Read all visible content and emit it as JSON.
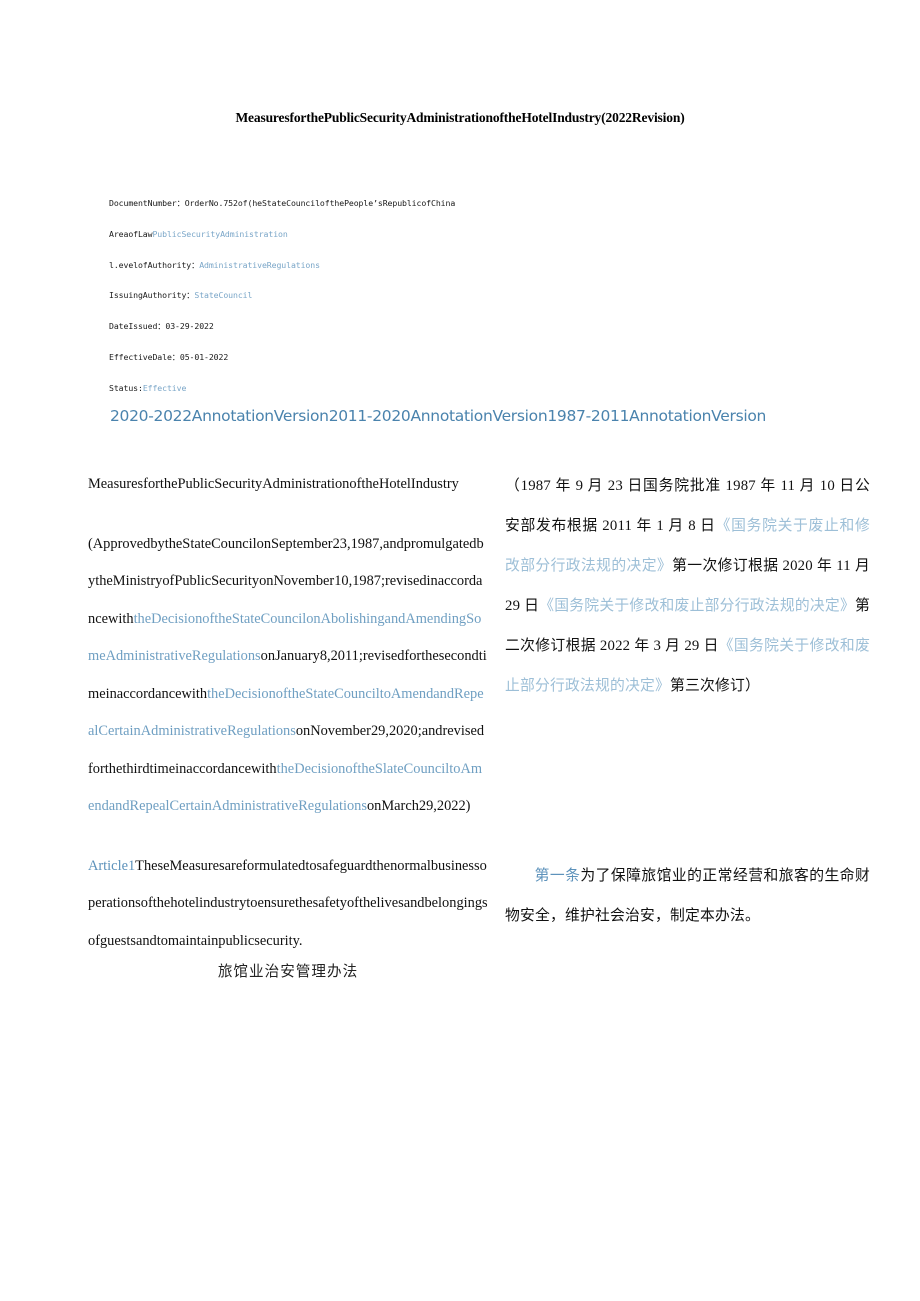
{
  "document": {
    "title": "MeasuresforthePublicSecurityAdministrationoftheHotelIndustry(2022Revision)"
  },
  "metadata": {
    "rows": [
      {
        "label": "DocumentNumber：",
        "value": "OrderNo.752of(heStateCouncilofthePеople’sRepublicofChina",
        "is_link": false
      },
      {
        "label": "AreaofLaw",
        "value": "PublicSecurityAdministration",
        "is_link": true
      },
      {
        "label": "l.evelofAuthority：",
        "value": "AdministrativeRegulations",
        "is_link": true
      },
      {
        "label": "IssuingAuthority：",
        "value": "StateCouncil",
        "is_link": true
      },
      {
        "label": "DateIssued：",
        "value": "03-29-2022",
        "is_link": false
      },
      {
        "label": "EffectiveDale：",
        "value": "05-01-2022",
        "is_link": false
      },
      {
        "label": "Status:",
        "value": "Effective",
        "is_link": true
      }
    ]
  },
  "annotation_versions": {
    "links": [
      "2020-2022AnnotationVersion",
      "2011-2020AnnotationVersion",
      "1987-2011AnnotationVersion"
    ]
  },
  "left_column": {
    "heading": "MeasuresforthePublicSecurityAdministrationoftheHotelIndustry",
    "preamble": {
      "seg1": "(ApprovedbytheStateCouncilonSeptember23,1987,andpromulgatedbytheMinistryofPublicSecurityonNovember10,1987;revisedinaccordancewith",
      "link1": "theDecisionoftheStateCouncilonAbolishingandAmendingSomeAdministrativeRegulations",
      "seg2": "onJanuary8,2011;revisedforthesecondtimeinaccordancewith",
      "link2": "theDecisionoftheStateCounciltoAmendandRepealCertainAdministrativeRegulations",
      "seg3": "onNovember29,2020;andrevisedforthethirdtimeinaccordancewith",
      "link3": "theDecisionoftheSlateCounciltoAmendandRepealCertainAdministrativeRegulations",
      "seg4": "onMarch29,2022)"
    },
    "article1": {
      "link": "Article1",
      "text": "TheseMeasuresareformulatedtosafeguardthenormalbusinessoperationsofthehotelindustrytoensurethesafetyofthelivesandbelongingsofguestsandtomaintainpublicsecurity."
    },
    "cn_title": "旅馆业治安管理办法"
  },
  "right_column": {
    "preamble": {
      "seg1": "（1987 年 9 月 23 日国务院批准 1987 年 11 月 10 日公安部发布根据 2011 年 1 月 8 日",
      "link1": "《国务院关于废止和修改部分行政法规的决定》",
      "seg2": "第一次修订根据 2020 年 11 月 29 日",
      "link2": "《国务院关于修改和废止部分行政法规的决定》",
      "seg3": "第二次修订根据 2022 年 3 月 29 日",
      "link3": "《国务院关于修改和废止部分行政法规的决定》",
      "seg4": "第三次修订）"
    },
    "article1": {
      "link": "第一条",
      "text": "为了保障旅馆业的正常经营和旅客的生命财物安全，维护社会治安，制定本办法。"
    }
  },
  "colors": {
    "link_blue": "#6f9fc2",
    "annotation_blue": "#4a83ad",
    "cn_link_blue": "#9dbfd7",
    "text_black": "#111111",
    "background": "#ffffff"
  }
}
